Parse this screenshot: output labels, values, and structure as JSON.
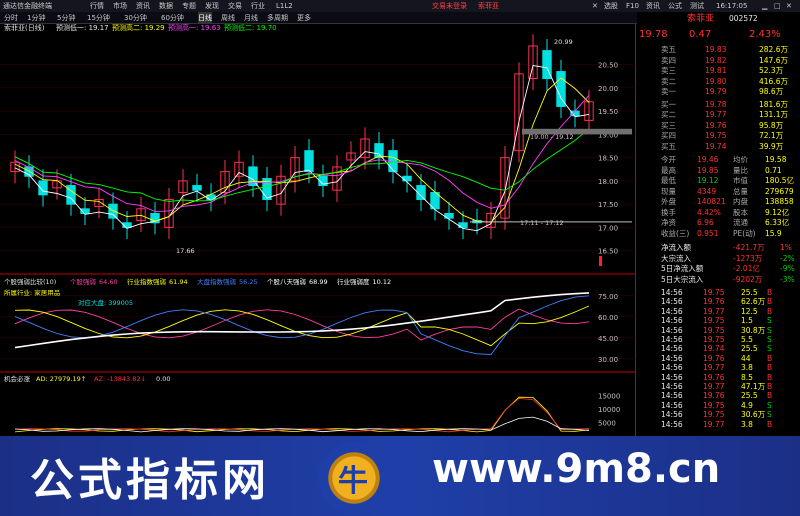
{
  "titlebar": {
    "app_name": "通达信金融终端",
    "menus": [
      "行情",
      "市场",
      "资讯",
      "数据",
      "专题",
      "发现",
      "交易",
      "行业",
      "L1L2"
    ],
    "promo": [
      "交易未登录",
      "索菲亚"
    ],
    "right_items": [
      "✕",
      "选股",
      "F10",
      "资讯",
      "公式",
      "测试"
    ]
  },
  "tabs": [
    "分时",
    "1分钟",
    "5分钟",
    "15分钟",
    "30分钟",
    "60分钟",
    "日线",
    "周线",
    "月线",
    "多周期",
    "更多"
  ],
  "tabs_active": "日线",
  "main_chart": {
    "header_name": "索菲亚(日线)",
    "header_items": [
      {
        "label": "预测低一: 19.17",
        "color": "#e8e8e8"
      },
      {
        "label": "预测高二: 19.29",
        "color": "#ffff00"
      },
      {
        "label": "预测高一: 19.63",
        "color": "#ff40ff"
      },
      {
        "label": "预测低二: 19.70",
        "color": "#00ff00"
      }
    ],
    "y_labels": [
      "20.50",
      "20.00",
      "19.50",
      "19.00",
      "18.50",
      "18.00",
      "17.50",
      "17.00",
      "16.50"
    ],
    "annotation_high": "20.99",
    "annotation_low": "17.66",
    "band1_label": "19.00 - 19.12",
    "band2_label": "17.11 - 17.12"
  },
  "chart_data": {
    "type": "line",
    "candles_close": [
      18.4,
      18.1,
      17.7,
      18.0,
      17.5,
      17.3,
      17.6,
      17.2,
      17.0,
      17.4,
      17.1,
      17.6,
      18.0,
      17.8,
      17.6,
      18.2,
      18.4,
      17.9,
      17.6,
      18.1,
      18.5,
      18.2,
      17.9,
      18.3,
      18.6,
      18.9,
      18.5,
      18.2,
      18.0,
      17.6,
      17.4,
      17.2,
      17.0,
      17.1,
      17.3,
      18.5,
      20.3,
      20.9,
      20.2,
      19.6,
      19.4,
      19.7
    ],
    "indicator_panel": {
      "title": "个股强弱比较(10)",
      "series": [
        {
          "name": "个股强弱",
          "value": "64.60",
          "color": "#ff40a0"
        },
        {
          "name": "行业指数强弱",
          "value": "61.94",
          "color": "#ffff00"
        },
        {
          "name": "大盘指数强弱",
          "value": "56.25",
          "color": "#4080ff"
        },
        {
          "name": "个股八天强弱",
          "value": "68.99",
          "color": "#ffffff"
        },
        {
          "name": "行业强弱度",
          "value": "10.12",
          "color": "#ffffff"
        }
      ],
      "industry_label": "所属行业: 家居用品",
      "vs_market_label": "对应大盘: 399005",
      "y_labels": [
        "75.00",
        "60.00",
        "45.00",
        "30.00"
      ]
    },
    "capital_panel": {
      "title": "机会必涨",
      "ad_label": "AD: 27979.19↑",
      "az_label": "AZ: -13843.82↓",
      "az_value_hint": "0.00",
      "y_labels": [
        "15000",
        "10000",
        "5000"
      ]
    }
  },
  "right_panel": {
    "stock_name": "索菲亚",
    "stock_code": "002572",
    "price": "19.78",
    "change": "0.47",
    "change_pct": "2.43%",
    "asks": [
      {
        "label": "卖五",
        "price": "19.83",
        "vol": "282.6万"
      },
      {
        "label": "卖四",
        "price": "19.82",
        "vol": "147.6万"
      },
      {
        "label": "卖三",
        "price": "19.81",
        "vol": "52.3万"
      },
      {
        "label": "卖二",
        "price": "19.80",
        "vol": "416.6万"
      },
      {
        "label": "卖一",
        "price": "19.79",
        "vol": "98.6万"
      }
    ],
    "bids": [
      {
        "label": "买一",
        "price": "19.78",
        "vol": "181.6万"
      },
      {
        "label": "买二",
        "price": "19.77",
        "vol": "131.1万"
      },
      {
        "label": "买三",
        "price": "19.76",
        "vol": "95.8万"
      },
      {
        "label": "买四",
        "price": "19.75",
        "vol": "72.1万"
      },
      {
        "label": "买五",
        "price": "19.74",
        "vol": "39.9万"
      }
    ],
    "stats": [
      {
        "l1": "今开",
        "v1": "19.46",
        "l2": "均价",
        "v2": "19.58"
      },
      {
        "l1": "最高",
        "v1": "19.85",
        "l2": "量比",
        "v2": "0.71"
      },
      {
        "l1": "最低",
        "v1": "19.12",
        "l2": "市值",
        "v2": "180.5亿"
      },
      {
        "l1": "现量",
        "v1": "4349",
        "l2": "总量",
        "v2": "279679"
      },
      {
        "l1": "外盘",
        "v1": "140821",
        "l2": "内盘",
        "v2": "138858"
      },
      {
        "l1": "换手",
        "v1": "4.42%",
        "l2": "股本",
        "v2": "9.12亿"
      },
      {
        "l1": "净资",
        "v1": "6.96",
        "l2": "流通",
        "v2": "6.33亿"
      },
      {
        "l1": "收益(三)",
        "v1": "0.951",
        "l2": "PE(动)",
        "v2": "15.9"
      }
    ],
    "flows": [
      {
        "label": "净流入额",
        "value": "-421.7万",
        "pct": "1%"
      },
      {
        "label": "大宗流入",
        "value": "-1273万",
        "pct": "-2%"
      },
      {
        "label": "5日净流入额",
        "value": "-2.01亿",
        "pct": "-9%"
      },
      {
        "label": "5日大宗流入",
        "value": "-9202万",
        "pct": "-3%"
      }
    ],
    "ticks": [
      {
        "t": "14:56",
        "p": "19.75",
        "v": "25.5",
        "s": "B"
      },
      {
        "t": "14:56",
        "p": "19.76",
        "v": "62.6万",
        "s": "B"
      },
      {
        "t": "14:56",
        "p": "19.77",
        "v": "12.5",
        "s": "B"
      },
      {
        "t": "14:56",
        "p": "19.75",
        "v": "1.5",
        "s": "S"
      },
      {
        "t": "14:56",
        "p": "19.75",
        "v": "30.8万",
        "s": "S"
      },
      {
        "t": "14:56",
        "p": "19.75",
        "v": "5.5",
        "s": "S"
      },
      {
        "t": "14:56",
        "p": "19.74",
        "v": "25.5",
        "s": "S"
      },
      {
        "t": "14:56",
        "p": "19.76",
        "v": "44",
        "s": "B"
      },
      {
        "t": "14:56",
        "p": "19.77",
        "v": "3.8",
        "s": "B"
      },
      {
        "t": "14:56",
        "p": "19.76",
        "v": "8.5",
        "s": "B"
      },
      {
        "t": "14:56",
        "p": "19.77",
        "v": "47.1万",
        "s": "B"
      },
      {
        "t": "14:56",
        "p": "19.76",
        "v": "25.5",
        "s": "B"
      },
      {
        "t": "14:56",
        "p": "19.75",
        "v": "4.9",
        "s": "S"
      },
      {
        "t": "14:56",
        "p": "19.75",
        "v": "30.6万",
        "s": "S"
      },
      {
        "t": "14:56",
        "p": "19.77",
        "v": "3.8",
        "s": "B"
      },
      {
        "t": "14:56",
        "p": "19.77",
        "v": "22.5",
        "s": "S"
      }
    ],
    "time": "16:17:05"
  },
  "banner": {
    "left": "公式指标网",
    "right": "www.9m8.cn",
    "logo": "牛"
  }
}
